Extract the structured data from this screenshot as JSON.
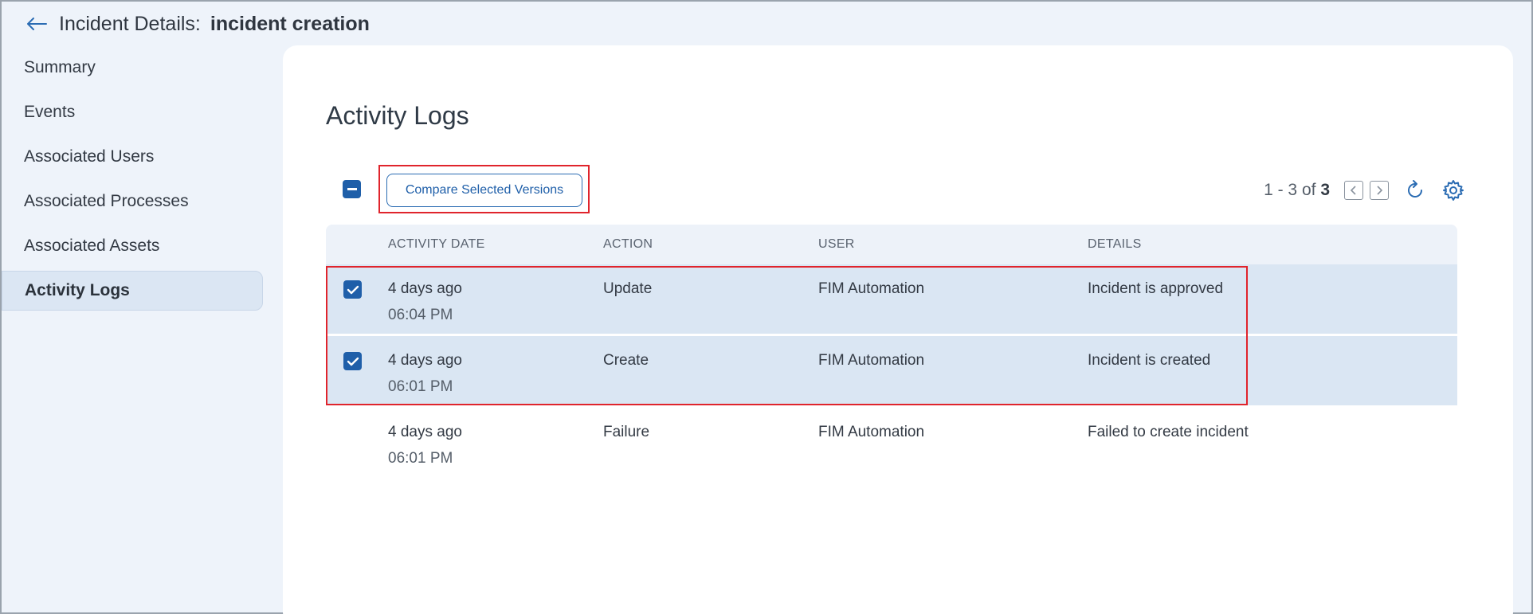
{
  "header": {
    "prefix": "Incident Details:",
    "title": "incident creation"
  },
  "sidebar": {
    "items": [
      {
        "label": "Summary"
      },
      {
        "label": "Events"
      },
      {
        "label": "Associated Users"
      },
      {
        "label": "Associated Processes"
      },
      {
        "label": "Associated Assets"
      },
      {
        "label": "Activity Logs",
        "active": true
      }
    ]
  },
  "main": {
    "title": "Activity Logs",
    "compare_button": "Compare Selected Versions",
    "pager": {
      "range": "1 - 3 of",
      "total": "3"
    },
    "columns": [
      "ACTIVITY DATE",
      "ACTION",
      "USER",
      "DETAILS"
    ],
    "rows": [
      {
        "date": "4 days ago",
        "time": "06:04 PM",
        "action": "Update",
        "user": "FIM Automation",
        "details": "Incident is approved",
        "selected": true
      },
      {
        "date": "4 days ago",
        "time": "06:01 PM",
        "action": "Create",
        "user": "FIM Automation",
        "details": "Incident is created",
        "selected": true
      },
      {
        "date": "4 days ago",
        "time": "06:01 PM",
        "action": "Failure",
        "user": "FIM Automation",
        "details": "Failed to create incident",
        "selected": false
      }
    ]
  },
  "icons": {
    "back": "arrow-left-icon",
    "refresh": "refresh-icon",
    "settings": "gear-icon",
    "prev": "chevron-left-icon",
    "next": "chevron-right-icon"
  },
  "colors": {
    "accent": "#1f5fa9",
    "highlight": "#e0242c",
    "selected_row": "#dae6f3"
  }
}
